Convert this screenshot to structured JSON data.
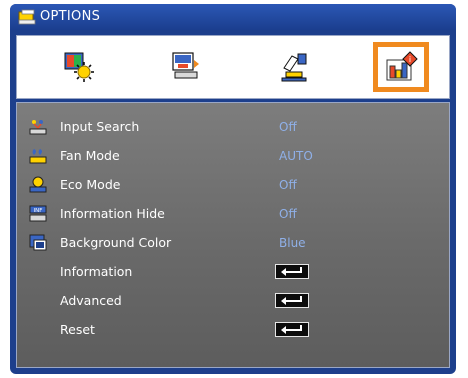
{
  "window": {
    "title": "OPTIONS"
  },
  "tabs": [
    {
      "icon": "picture-settings-icon",
      "active": false
    },
    {
      "icon": "display-settings-icon",
      "active": false
    },
    {
      "icon": "setup-settings-icon",
      "active": false
    },
    {
      "icon": "options-settings-icon",
      "active": true
    }
  ],
  "items": [
    {
      "label": "Input Search",
      "value": "Off",
      "icon": "input-search-icon"
    },
    {
      "label": "Fan Mode",
      "value": "AUTO",
      "icon": "fan-mode-icon"
    },
    {
      "label": "Eco Mode",
      "value": "Off",
      "icon": "eco-mode-icon"
    },
    {
      "label": "Information Hide",
      "value": "Off",
      "icon": "information-hide-icon"
    },
    {
      "label": "Background Color",
      "value": "Blue",
      "icon": "background-color-icon"
    },
    {
      "label": "Information",
      "action": "enter"
    },
    {
      "label": "Advanced",
      "action": "enter"
    },
    {
      "label": "Reset",
      "action": "enter"
    }
  ],
  "colors": {
    "accent": "#f08a1f",
    "window": "#1d3f8c",
    "value_text": "#8fb0e8"
  }
}
